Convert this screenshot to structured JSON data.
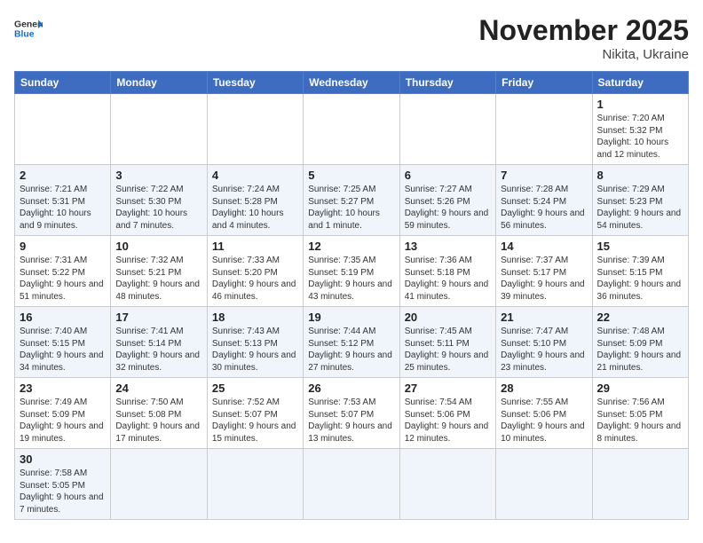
{
  "header": {
    "logo_general": "General",
    "logo_blue": "Blue",
    "month_title": "November 2025",
    "subtitle": "Nikita, Ukraine"
  },
  "days_of_week": [
    "Sunday",
    "Monday",
    "Tuesday",
    "Wednesday",
    "Thursday",
    "Friday",
    "Saturday"
  ],
  "weeks": [
    [
      {
        "day": "",
        "info": ""
      },
      {
        "day": "",
        "info": ""
      },
      {
        "day": "",
        "info": ""
      },
      {
        "day": "",
        "info": ""
      },
      {
        "day": "",
        "info": ""
      },
      {
        "day": "",
        "info": ""
      },
      {
        "day": "1",
        "info": "Sunrise: 7:20 AM\nSunset: 5:32 PM\nDaylight: 10 hours\nand 12 minutes."
      }
    ],
    [
      {
        "day": "2",
        "info": "Sunrise: 7:21 AM\nSunset: 5:31 PM\nDaylight: 10 hours\nand 9 minutes."
      },
      {
        "day": "3",
        "info": "Sunrise: 7:22 AM\nSunset: 5:30 PM\nDaylight: 10 hours\nand 7 minutes."
      },
      {
        "day": "4",
        "info": "Sunrise: 7:24 AM\nSunset: 5:28 PM\nDaylight: 10 hours\nand 4 minutes."
      },
      {
        "day": "5",
        "info": "Sunrise: 7:25 AM\nSunset: 5:27 PM\nDaylight: 10 hours\nand 1 minute."
      },
      {
        "day": "6",
        "info": "Sunrise: 7:27 AM\nSunset: 5:26 PM\nDaylight: 9 hours\nand 59 minutes."
      },
      {
        "day": "7",
        "info": "Sunrise: 7:28 AM\nSunset: 5:24 PM\nDaylight: 9 hours\nand 56 minutes."
      },
      {
        "day": "8",
        "info": "Sunrise: 7:29 AM\nSunset: 5:23 PM\nDaylight: 9 hours\nand 54 minutes."
      }
    ],
    [
      {
        "day": "9",
        "info": "Sunrise: 7:31 AM\nSunset: 5:22 PM\nDaylight: 9 hours\nand 51 minutes."
      },
      {
        "day": "10",
        "info": "Sunrise: 7:32 AM\nSunset: 5:21 PM\nDaylight: 9 hours\nand 48 minutes."
      },
      {
        "day": "11",
        "info": "Sunrise: 7:33 AM\nSunset: 5:20 PM\nDaylight: 9 hours\nand 46 minutes."
      },
      {
        "day": "12",
        "info": "Sunrise: 7:35 AM\nSunset: 5:19 PM\nDaylight: 9 hours\nand 43 minutes."
      },
      {
        "day": "13",
        "info": "Sunrise: 7:36 AM\nSunset: 5:18 PM\nDaylight: 9 hours\nand 41 minutes."
      },
      {
        "day": "14",
        "info": "Sunrise: 7:37 AM\nSunset: 5:17 PM\nDaylight: 9 hours\nand 39 minutes."
      },
      {
        "day": "15",
        "info": "Sunrise: 7:39 AM\nSunset: 5:15 PM\nDaylight: 9 hours\nand 36 minutes."
      }
    ],
    [
      {
        "day": "16",
        "info": "Sunrise: 7:40 AM\nSunset: 5:15 PM\nDaylight: 9 hours\nand 34 minutes."
      },
      {
        "day": "17",
        "info": "Sunrise: 7:41 AM\nSunset: 5:14 PM\nDaylight: 9 hours\nand 32 minutes."
      },
      {
        "day": "18",
        "info": "Sunrise: 7:43 AM\nSunset: 5:13 PM\nDaylight: 9 hours\nand 30 minutes."
      },
      {
        "day": "19",
        "info": "Sunrise: 7:44 AM\nSunset: 5:12 PM\nDaylight: 9 hours\nand 27 minutes."
      },
      {
        "day": "20",
        "info": "Sunrise: 7:45 AM\nSunset: 5:11 PM\nDaylight: 9 hours\nand 25 minutes."
      },
      {
        "day": "21",
        "info": "Sunrise: 7:47 AM\nSunset: 5:10 PM\nDaylight: 9 hours\nand 23 minutes."
      },
      {
        "day": "22",
        "info": "Sunrise: 7:48 AM\nSunset: 5:09 PM\nDaylight: 9 hours\nand 21 minutes."
      }
    ],
    [
      {
        "day": "23",
        "info": "Sunrise: 7:49 AM\nSunset: 5:09 PM\nDaylight: 9 hours\nand 19 minutes."
      },
      {
        "day": "24",
        "info": "Sunrise: 7:50 AM\nSunset: 5:08 PM\nDaylight: 9 hours\nand 17 minutes."
      },
      {
        "day": "25",
        "info": "Sunrise: 7:52 AM\nSunset: 5:07 PM\nDaylight: 9 hours\nand 15 minutes."
      },
      {
        "day": "26",
        "info": "Sunrise: 7:53 AM\nSunset: 5:07 PM\nDaylight: 9 hours\nand 13 minutes."
      },
      {
        "day": "27",
        "info": "Sunrise: 7:54 AM\nSunset: 5:06 PM\nDaylight: 9 hours\nand 12 minutes."
      },
      {
        "day": "28",
        "info": "Sunrise: 7:55 AM\nSunset: 5:06 PM\nDaylight: 9 hours\nand 10 minutes."
      },
      {
        "day": "29",
        "info": "Sunrise: 7:56 AM\nSunset: 5:05 PM\nDaylight: 9 hours\nand 8 minutes."
      }
    ],
    [
      {
        "day": "30",
        "info": "Sunrise: 7:58 AM\nSunset: 5:05 PM\nDaylight: 9 hours\nand 7 minutes."
      },
      {
        "day": "",
        "info": ""
      },
      {
        "day": "",
        "info": ""
      },
      {
        "day": "",
        "info": ""
      },
      {
        "day": "",
        "info": ""
      },
      {
        "day": "",
        "info": ""
      },
      {
        "day": "",
        "info": ""
      }
    ]
  ]
}
